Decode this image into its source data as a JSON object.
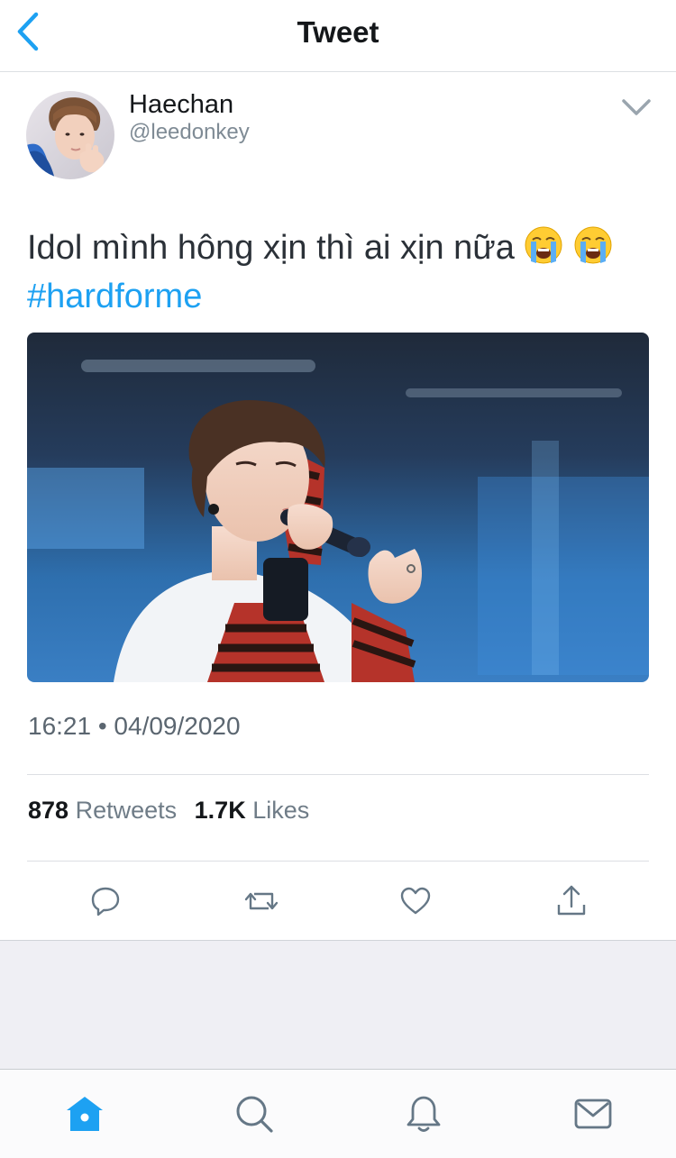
{
  "header": {
    "title": "Tweet"
  },
  "tweet": {
    "author": {
      "name": "Haechan",
      "handle": "@leedonkey"
    },
    "text_main": "Idol mình hông xịn thì ai xịn nữa",
    "hashtag": "#hardforme",
    "timestamp": "16:21 • 04/09/2020",
    "stats": {
      "retweets_count": "878",
      "retweets_label": "Retweets",
      "likes_count": "1.7K",
      "likes_label": "Likes"
    }
  },
  "actions": [
    "reply-icon",
    "retweet-icon",
    "like-icon",
    "share-icon"
  ],
  "tabbar": {
    "tabs": [
      "home-icon",
      "search-icon",
      "notifications-icon",
      "messages-icon"
    ],
    "active": "home-icon"
  },
  "colors": {
    "accent": "#1da1f2",
    "text": "#14171a",
    "secondary": "#6f7c87",
    "icon": "#657786"
  }
}
